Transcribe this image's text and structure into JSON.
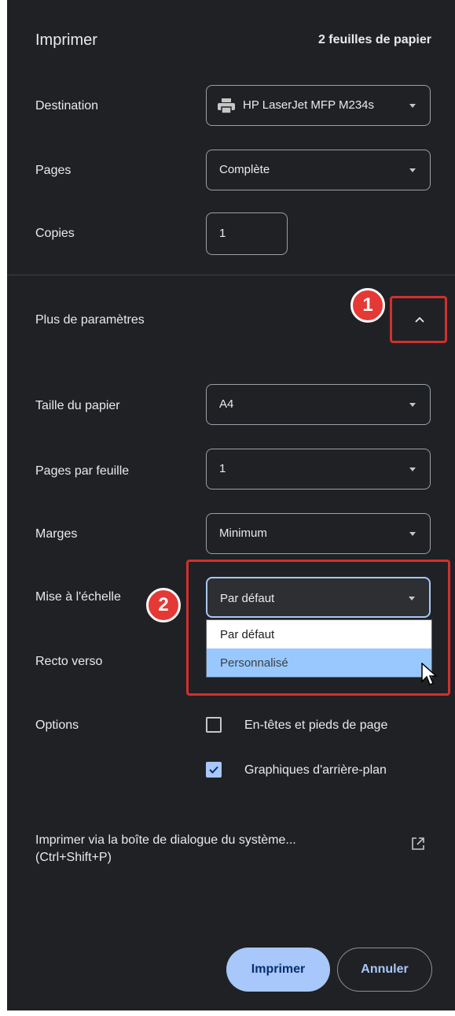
{
  "header": {
    "title": "Imprimer",
    "sheets": "2 feuilles de papier"
  },
  "destination": {
    "label": "Destination",
    "value": "HP LaserJet MFP M234s",
    "icon": "printer-icon"
  },
  "pages": {
    "label": "Pages",
    "value": "Complète"
  },
  "copies": {
    "label": "Copies",
    "value": "1"
  },
  "more_settings": {
    "label": "Plus de paramètres",
    "expanded": true
  },
  "paper_size": {
    "label": "Taille du papier",
    "value": "A4"
  },
  "pages_per_sheet": {
    "label": "Pages par feuille",
    "value": "1"
  },
  "margins": {
    "label": "Marges",
    "value": "Minimum"
  },
  "scale": {
    "label": "Mise à l'échelle",
    "value": "Par défaut",
    "options": [
      "Par défaut",
      "Personnalisé"
    ],
    "highlighted": "Personnalisé"
  },
  "duplex": {
    "label": "Recto verso"
  },
  "options": {
    "label": "Options",
    "headers_footers": {
      "label": "En-têtes et pieds de page",
      "checked": false
    },
    "background_graphics": {
      "label": "Graphiques d'arrière-plan",
      "checked": true
    }
  },
  "system_dialog": {
    "line1": "Imprimer via la boîte de dialogue du système...",
    "line2": "(Ctrl+Shift+P)"
  },
  "actions": {
    "print": "Imprimer",
    "cancel": "Annuler"
  },
  "annotations": {
    "badge1": "1",
    "badge2": "2"
  },
  "colors": {
    "panel_bg": "#202124",
    "accent": "#a8c7fa",
    "highlight": "#d32f2f",
    "option_highlight": "#99c8ff"
  }
}
